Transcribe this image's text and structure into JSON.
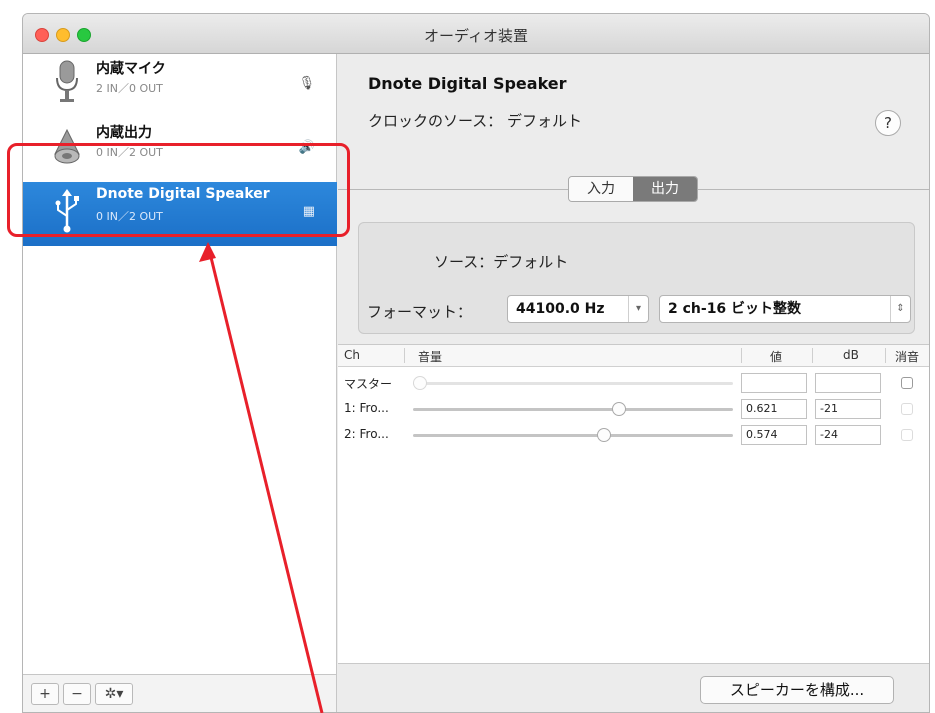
{
  "window": {
    "title": "オーディオ装置"
  },
  "devices": [
    {
      "name": "内蔵マイク",
      "io": "2 IN／0 OUT",
      "icon": "microphone-icon",
      "badge": "🎙"
    },
    {
      "name": "内蔵出力",
      "io": "0 IN／2 OUT",
      "icon": "speaker-icon",
      "badge": "🔊"
    },
    {
      "name": "Dnote Digital Speaker",
      "io": "0 IN／2 OUT",
      "icon": "usb-icon",
      "badge": "▦",
      "selected": true
    }
  ],
  "sidebar_footer": {
    "add": "+",
    "remove": "−",
    "gear": "✲▾"
  },
  "detail": {
    "device_title": "Dnote Digital Speaker",
    "clock_source": "クロックのソース： デフォルト",
    "help": "?",
    "tabs": {
      "input": "入力",
      "output": "出力",
      "active": "output"
    },
    "source": "ソース：デフォルト",
    "format_label": "フォーマット：",
    "sample_rate": "44100.0 Hz",
    "bit_format": "2 ch-16 ビット整数",
    "configure_button": "スピーカーを構成..."
  },
  "volume_table": {
    "headers": {
      "ch": "Ch",
      "volume": "音量",
      "value": "値",
      "db": "dB",
      "mute": "消音"
    },
    "rows": [
      {
        "name": "マスター",
        "level": 0.0,
        "value": "",
        "db": "",
        "enabled": false
      },
      {
        "name": "1: Fro...",
        "level": 0.621,
        "value": "0.621",
        "db": "-21",
        "enabled": true
      },
      {
        "name": "2: Fro...",
        "level": 0.574,
        "value": "0.574",
        "db": "-24",
        "enabled": true
      }
    ]
  },
  "colors": {
    "selection": "#1b6fc7",
    "annotation": "#e8202a"
  }
}
